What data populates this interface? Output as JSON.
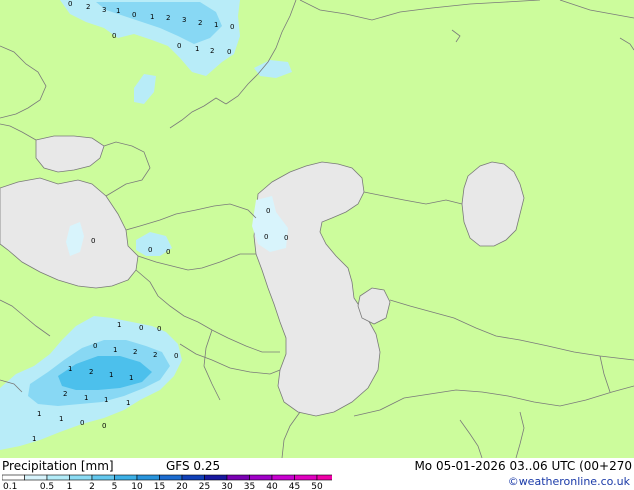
{
  "map_values": {
    "north": [
      "0",
      "2",
      "3",
      "1",
      "0",
      "1",
      "2",
      "3",
      "2",
      "1",
      "0",
      "0",
      "0",
      "1",
      "2",
      "0"
    ],
    "west_mid": [
      "0",
      "0",
      "0"
    ],
    "caspian_west": [
      "0",
      "0",
      "0"
    ],
    "southwest": [
      "1",
      "0",
      "0",
      "0",
      "1",
      "2",
      "2",
      "0",
      "1",
      "2",
      "1",
      "1",
      "2",
      "1",
      "1",
      "1",
      "1",
      "1",
      "0",
      "0",
      "1"
    ]
  },
  "footer": {
    "legend_title": "Precipitation [mm]",
    "model": "GFS 0.25",
    "run_info": "Mo 05-01-2026 03..06 UTC (00+270",
    "credit": "©weatheronline.co.uk"
  },
  "legend": {
    "ticks": [
      "0.1",
      "0.5",
      "1",
      "2",
      "5",
      "10",
      "15",
      "20",
      "25",
      "30",
      "35",
      "40",
      "45",
      "50"
    ],
    "colors": [
      "#ffffff",
      "#d8f4fc",
      "#b4ecf8",
      "#8cdcf4",
      "#64c8ee",
      "#3cb0e6",
      "#2894dc",
      "#1c6cd0",
      "#1040b8",
      "#1818a0",
      "#7a00b4",
      "#a000c8",
      "#c800d0",
      "#e000c0",
      "#f000a8"
    ]
  },
  "colors": {
    "land": "#ccfc9c",
    "water": "#e8e8e8",
    "border": "#7a7a7a",
    "precip_light": "#b8ecf8",
    "precip_mid": "#88d8f4",
    "precip_strong": "#4cc0ec"
  }
}
